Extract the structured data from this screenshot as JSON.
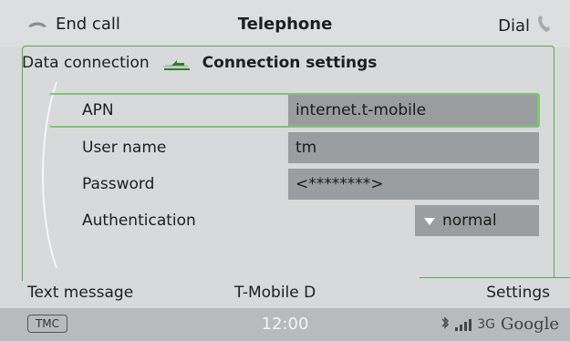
{
  "top": {
    "left_label": "End call",
    "title": "Telephone",
    "right_label": "Dial"
  },
  "subheader": {
    "crumb": "Data connection",
    "title": "Connection settings"
  },
  "fields": [
    {
      "label": "APN",
      "value": "internet.t-mobile"
    },
    {
      "label": "User name",
      "value": "tm"
    },
    {
      "label": "Password",
      "value": "<********>"
    },
    {
      "label": "Authentication",
      "value": "normal"
    }
  ],
  "tabs": {
    "left": "Text message",
    "center": "T-Mobile D",
    "right": "Settings"
  },
  "status": {
    "tmc": "TMC",
    "time": "12:00",
    "network": "3G",
    "brand": "Google"
  },
  "colors": {
    "accent": "#7bc86a",
    "panel": "#d7d9da",
    "field": "#9b9ea0",
    "statusbar": "#b8bbbd"
  }
}
